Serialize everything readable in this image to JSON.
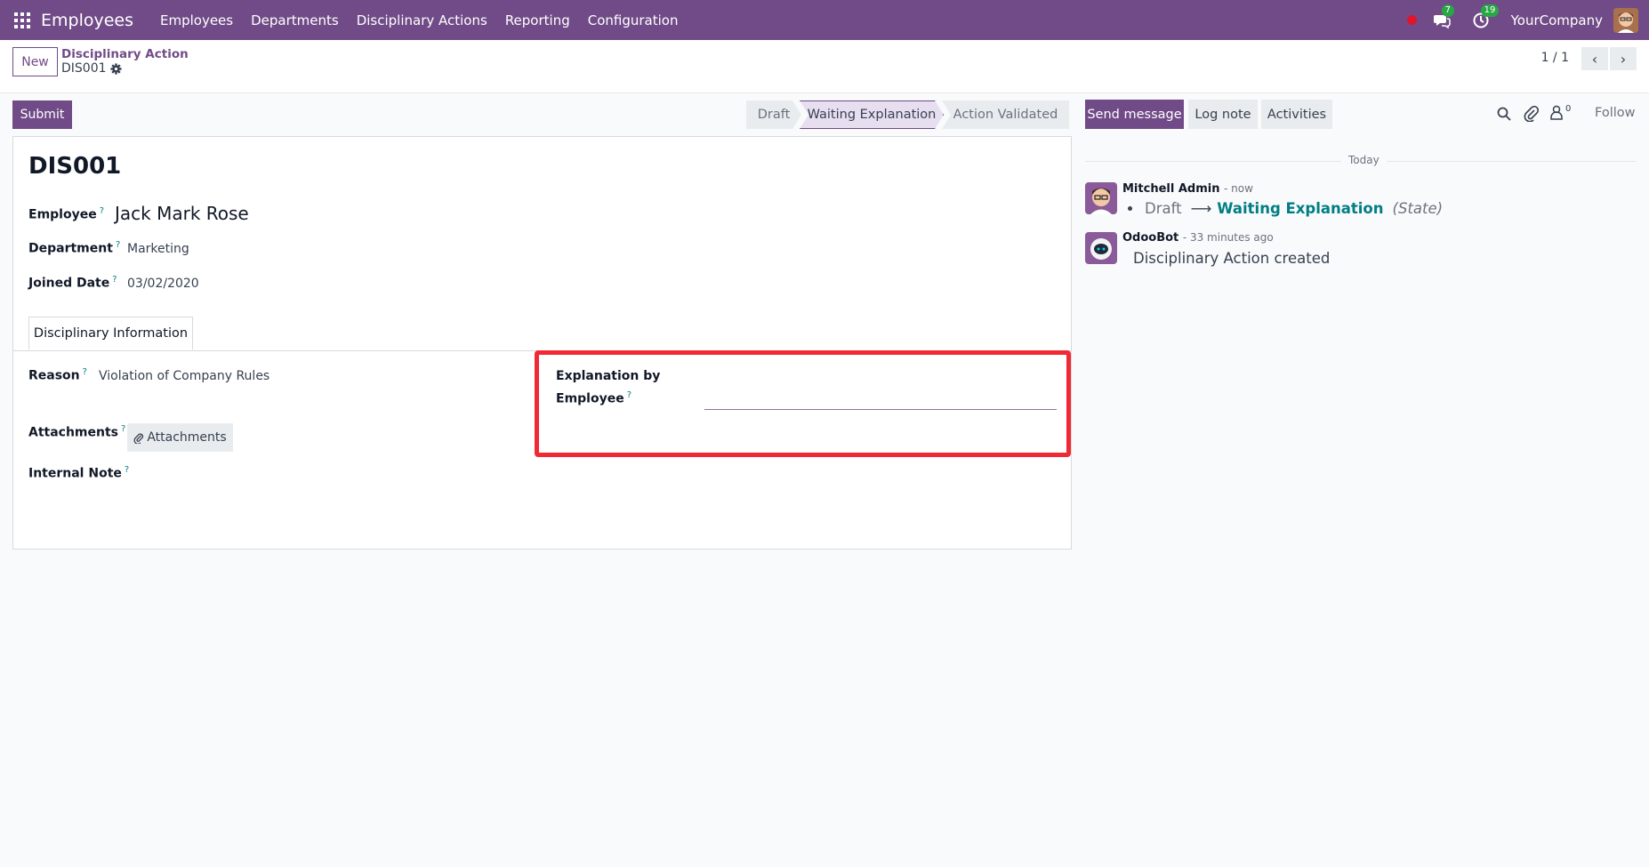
{
  "navbar": {
    "app_name": "Employees",
    "menu": [
      "Employees",
      "Departments",
      "Disciplinary Actions",
      "Reporting",
      "Configuration"
    ],
    "messages_count": "7",
    "activities_count": "19",
    "company": "YourCompany"
  },
  "control": {
    "new_label": "New",
    "breadcrumb_parent": "Disciplinary Action",
    "breadcrumb_current": "DIS001",
    "pager": "1 / 1"
  },
  "actions": {
    "submit_label": "Submit"
  },
  "statusbar": {
    "stages": [
      "Draft",
      "Waiting Explanation",
      "Action Validated"
    ],
    "active": "Waiting Explanation"
  },
  "form": {
    "record_name": "DIS001",
    "employee_label": "Employee",
    "employee_value": "Jack Mark Rose",
    "department_label": "Department",
    "department_value": "Marketing",
    "joined_label": "Joined Date",
    "joined_value": "03/02/2020",
    "tab_label": "Disciplinary Information",
    "reason_label": "Reason",
    "reason_value": "Violation of Company Rules",
    "attachments_label": "Attachments",
    "attachments_button": "Attachments",
    "internal_note_label": "Internal Note",
    "explanation_label_line1": "Explanation by",
    "explanation_label_line2": "Employee",
    "explanation_value": "",
    "help_mark": "?"
  },
  "chatter": {
    "send_message": "Send message",
    "log_note": "Log note",
    "activities": "Activities",
    "followers_count": "0",
    "follow": "Follow",
    "date_separator": "Today",
    "messages": [
      {
        "author": "Mitchell Admin",
        "time": "- now",
        "tracking_old": "Draft",
        "tracking_new": "Waiting Explanation",
        "tracking_field": "(State)"
      },
      {
        "author": "OdooBot",
        "time": "- 33 minutes ago",
        "body": "Disciplinary Action created"
      }
    ]
  },
  "colors": {
    "brand": "#714b87",
    "highlight": "#f02a34",
    "link": "#017e84"
  }
}
